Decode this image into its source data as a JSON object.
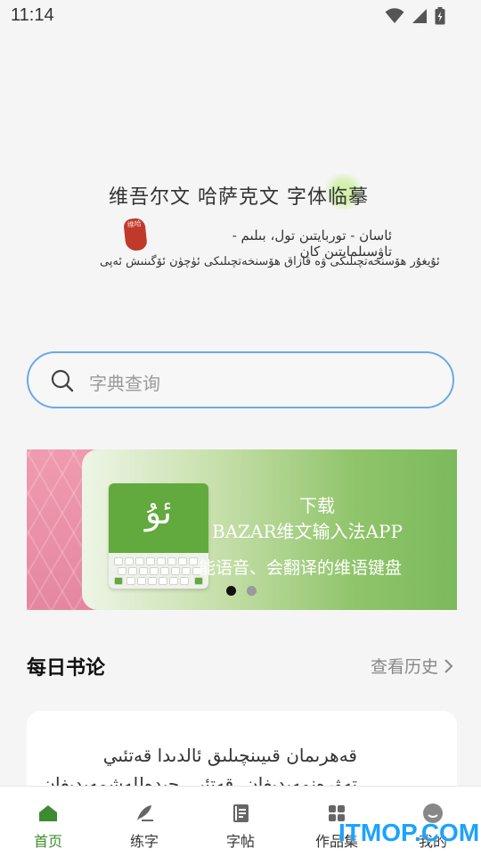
{
  "status_bar": {
    "time": "11:14",
    "icons": [
      "wifi-icon",
      "signal-icon",
      "battery-charging-icon"
    ]
  },
  "logo": {
    "title": "维吾尔文 哈萨克文 字体临摹",
    "seal_text": "维哈",
    "line2": "ئاسان - توربايتىن تول، بىلىم - تاۋسىلمايتىن كان",
    "line3": "ئۇيغۇر ھۆسنخەتچىلىكى ۋە قازاق ھۆسنخەتچىلىكى ئۈچۈن ئۆگىنىش ئەپى"
  },
  "search": {
    "placeholder": "字典查询",
    "icon": "search-icon"
  },
  "carousel": {
    "slide": {
      "keyboard_glyph": "ئۇ",
      "text1": "下载",
      "text2": "BAZAR维文输入法APP",
      "text3": "能语音、会翻译的维语键盘"
    },
    "active_index": 0,
    "count": 2
  },
  "daily": {
    "title": "每日书论",
    "history_label": "查看历史",
    "card_text": "قەھرىمان قىيىنچىلىق ئالدىدا قەتئىي تەۋرەنمەيدىغان، قەتئىي جىدەللەشمەيدىغان"
  },
  "tabbar": [
    {
      "label": "首页",
      "icon": "home-icon",
      "active": true
    },
    {
      "label": "练字",
      "icon": "brush-icon",
      "active": false
    },
    {
      "label": "字帖",
      "icon": "copybook-icon",
      "active": false
    },
    {
      "label": "作品集",
      "icon": "grid-icon",
      "active": false
    },
    {
      "label": "我的",
      "icon": "profile-icon",
      "active": false
    }
  ],
  "watermark": "ITMOP.COM",
  "colors": {
    "accent": "#3c8d2f",
    "search_border": "#6aa9e8",
    "banner_green": "#79b85a",
    "banner_pink": "#e586a0"
  }
}
